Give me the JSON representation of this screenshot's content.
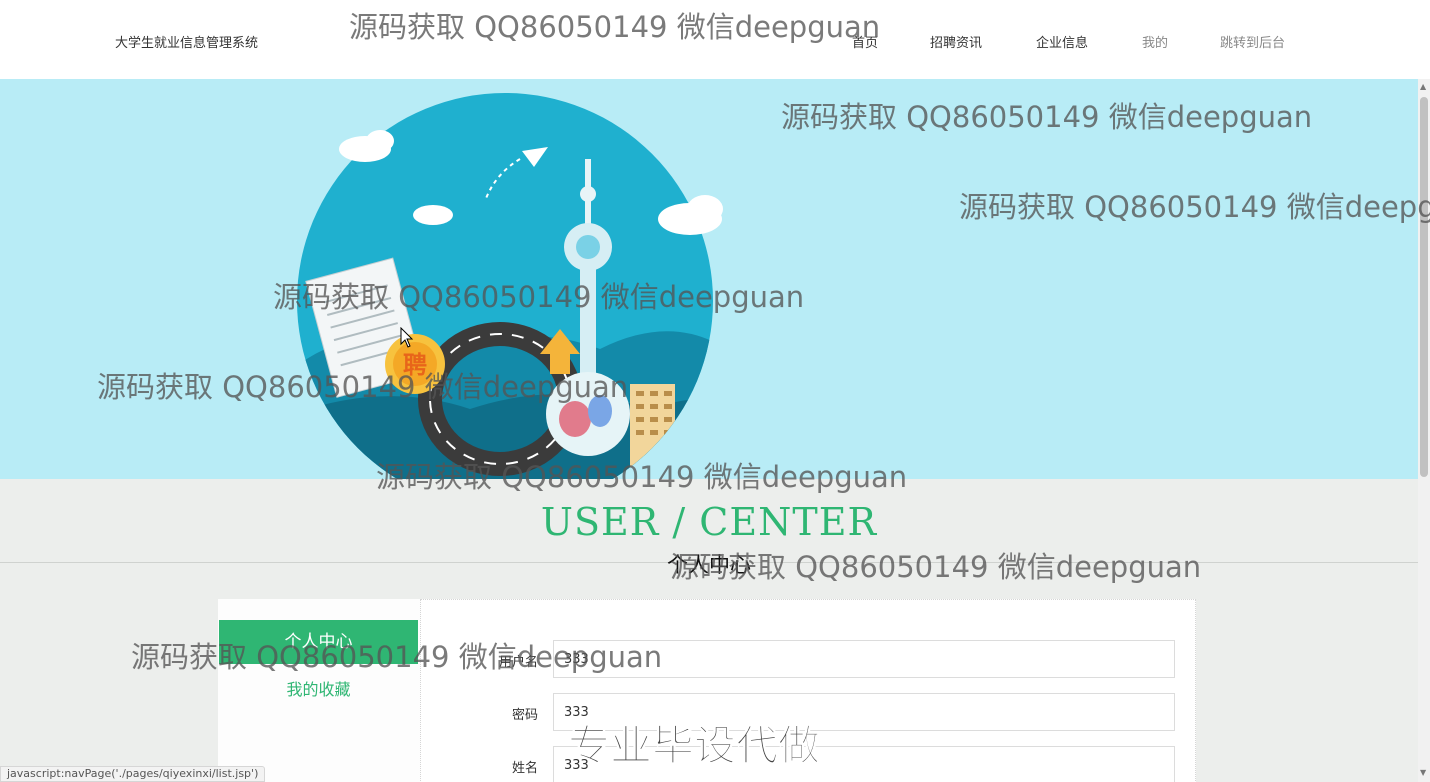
{
  "header": {
    "brand": "大学生就业信息管理系统",
    "nav": [
      {
        "label": "首页"
      },
      {
        "label": "招聘资讯"
      },
      {
        "label": "企业信息"
      },
      {
        "label": "我的"
      },
      {
        "label": "跳转到后台"
      }
    ]
  },
  "banner": {
    "badge_text": "聘"
  },
  "section": {
    "title": "USER / CENTER",
    "subtitle": "个人中心"
  },
  "sidebar": {
    "items": [
      {
        "label": "个人中心",
        "active": true
      },
      {
        "label": "我的收藏",
        "active": false
      }
    ]
  },
  "form": {
    "fields": [
      {
        "label": "用户名",
        "value": "333"
      },
      {
        "label": "密码",
        "value": "333"
      },
      {
        "label": "姓名",
        "value": "333"
      }
    ]
  },
  "watermarks": {
    "text": "源码获取 QQ86050149 微信deepguan",
    "overlay": "专业毕设代做"
  },
  "statusbar": {
    "text": "javascript:navPage('./pages/qiyexinxi/list.jsp')"
  },
  "colors": {
    "accent": "#2fb673",
    "banner_bg": "#b8ecf6",
    "page_bg": "#eceeec"
  }
}
